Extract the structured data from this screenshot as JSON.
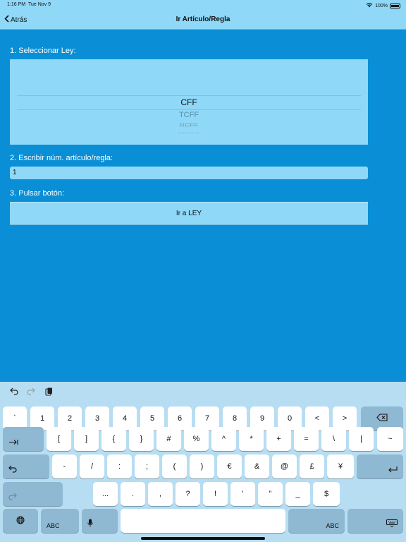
{
  "status_bar": {
    "time": "1:16 PM",
    "date": "Tue Nov 9",
    "battery": "100%"
  },
  "nav": {
    "back_label": "Atrás",
    "title": "Ir Artículo/Regla"
  },
  "form": {
    "step1_label": "1. Seleccionar Ley:",
    "picker_options": [
      "CFF",
      "TCFF",
      "RCFF",
      "ERCFF"
    ],
    "step2_label": "2. Escribir núm. artículo/regla:",
    "article_value": "1",
    "step3_label": "3. Pulsar botón:",
    "go_button_label": "Ir a LEY"
  },
  "keyboard": {
    "toolbar": {
      "undo_icon": "undo-icon",
      "redo_icon": "redo-icon",
      "paste_icon": "paste-icon"
    },
    "row1": [
      "`",
      "1",
      "2",
      "3",
      "4",
      "5",
      "6",
      "7",
      "8",
      "9",
      "0",
      "<",
      ">"
    ],
    "row2": [
      "[",
      "]",
      "{",
      "}",
      "#",
      "%",
      "^",
      "*",
      "+",
      "=",
      "\\",
      "|",
      "~"
    ],
    "row3": [
      "-",
      "/",
      ":",
      ";",
      "(",
      ")",
      "€",
      "&",
      "@",
      "£",
      "¥"
    ],
    "row4": [
      "...",
      ".",
      ",",
      "?",
      "!",
      "’",
      "”",
      "_",
      "$"
    ],
    "abc_left": "ABC",
    "abc_right": "ABC",
    "globe_icon": "globe-icon",
    "mic_icon": "mic-icon",
    "delete_icon": "delete-icon",
    "tab_icon": "tab-icon",
    "undo_key_icon": "undo-icon",
    "redo_key_icon": "redo-icon",
    "return_icon": "return-icon",
    "dismiss_icon": "keyboard-dismiss-icon"
  }
}
